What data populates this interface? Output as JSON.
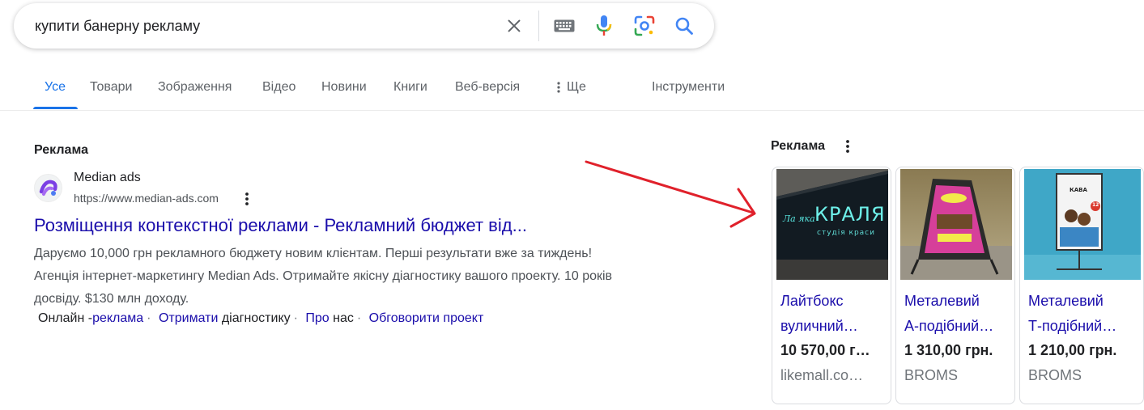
{
  "search": {
    "query": "купити банерну рекламу",
    "icons": [
      "close-icon",
      "keyboard-icon",
      "microphone-icon",
      "lens-icon",
      "search-icon"
    ]
  },
  "tabs": [
    {
      "label": "Усе",
      "active": true
    },
    {
      "label": "Товари"
    },
    {
      "label": "Зображення"
    },
    {
      "label": "Відео"
    },
    {
      "label": "Новини"
    },
    {
      "label": "Книги"
    },
    {
      "label": "Веб-версія"
    },
    {
      "label": "Ще"
    },
    {
      "label": "Інструменти"
    }
  ],
  "text_ad": {
    "label": "Реклама",
    "advertiser": "Median ads",
    "url": "https://www.median-ads.com",
    "title": "Розміщення контекстної реклами - Рекламний бюджет від...",
    "description": "Даруємо 10,000 грн рекламного бюджету новим клієнтам. Перші результати вже за тиждень! Агенція інтернет-маркетингу Median Ads. Отримайте якісну діагностику вашого проекту. 10 років досвіду. $130 млн доходу.",
    "sitelinks": [
      {
        "prefix": "Онлайн -",
        "link": "реклама",
        "suffix": ""
      },
      {
        "prefix": "",
        "link": "Отримати",
        "suffix": " діагностику"
      },
      {
        "prefix": "",
        "link": "Про",
        "suffix": " нас"
      },
      {
        "prefix": "",
        "link": "Обговорити проект",
        "suffix": ""
      }
    ],
    "separator": "·"
  },
  "shopping": {
    "label": "Реклама",
    "products": [
      {
        "title_line1": "Лайтбокс",
        "title_line2": "вуличний…",
        "price": "10 570,00 г…",
        "seller": "likemall.co…",
        "image_text_1": "Ла яка",
        "image_text_2": "КРАЛЯ",
        "image_text_3": "студія краси"
      },
      {
        "title_line1": "Металевий",
        "title_line2": "А-подібний…",
        "price": "1 310,00 грн.",
        "seller": "BROMS",
        "image_text_1": "",
        "image_text_2": "",
        "image_text_3": ""
      },
      {
        "title_line1": "Металевий",
        "title_line2": "Т-подібний…",
        "price": "1 210,00 грн.",
        "seller": "BROMS",
        "image_text_1": "КАВА",
        "image_text_2": "12",
        "image_text_3": ""
      }
    ]
  },
  "colors": {
    "accent": "#1a73e8",
    "link": "#1a0dab",
    "annotation_arrow": "#e0212b"
  }
}
